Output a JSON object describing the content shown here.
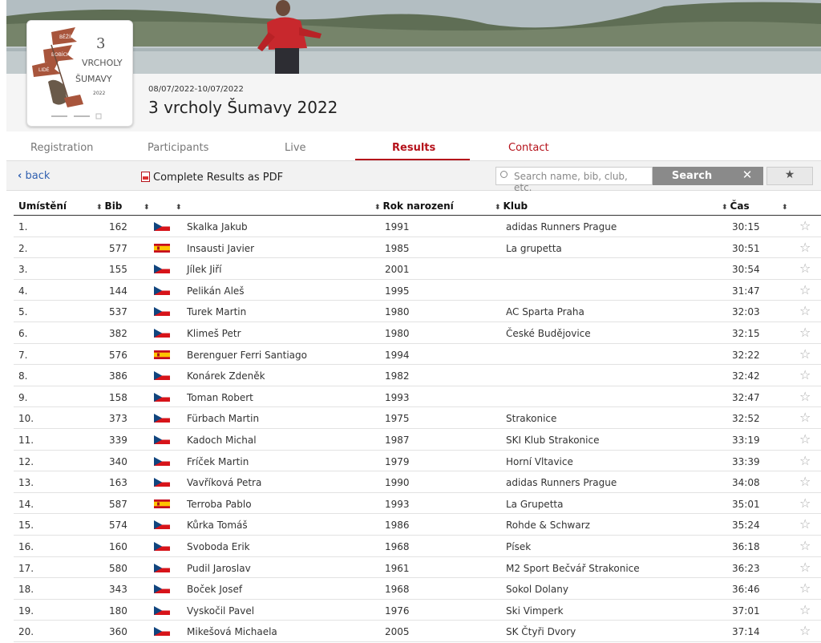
{
  "event": {
    "date": "08/07/2022-10/07/2022",
    "title": "3 vrcholy Šumavy 2022",
    "logo": {
      "numeral": "3",
      "line1": "VRCHOLY",
      "line2": "ŠUMAVY",
      "year": "2022",
      "flag_words": [
        "BĚŽÍNI",
        "BOBÍCI",
        "LIDÉ"
      ]
    }
  },
  "tabs": [
    {
      "label": "Registration"
    },
    {
      "label": "Participants"
    },
    {
      "label": "Live"
    },
    {
      "label": "Results",
      "active": true
    },
    {
      "label": "Contact"
    }
  ],
  "toolbar": {
    "back_label": "back",
    "pdf_label": "Complete Results as PDF",
    "search_placeholder": "Search name, bib, club, etc.",
    "search_label": "Search",
    "clear_label": "✕",
    "favorites_label": "★"
  },
  "columns": {
    "place": "Umístění",
    "bib": "Bib",
    "nation": "",
    "name": "",
    "birth_year": "Rok narození",
    "club": "Klub",
    "time": "Čas"
  },
  "colors": {
    "accent": "#b5121b",
    "link": "#3060b0"
  },
  "rows": [
    {
      "place": "1.",
      "bib": "162",
      "flag": "cz",
      "name": "Skalka Jakub",
      "year": "1991",
      "club": "adidas Runners Prague",
      "time": "30:15"
    },
    {
      "place": "2.",
      "bib": "577",
      "flag": "es",
      "name": "Insausti Javier",
      "year": "1985",
      "club": "La grupetta",
      "time": "30:51"
    },
    {
      "place": "3.",
      "bib": "155",
      "flag": "cz",
      "name": "Jílek Jiří",
      "year": "2001",
      "club": "",
      "time": "30:54"
    },
    {
      "place": "4.",
      "bib": "144",
      "flag": "cz",
      "name": "Pelikán Aleš",
      "year": "1995",
      "club": "",
      "time": "31:47"
    },
    {
      "place": "5.",
      "bib": "537",
      "flag": "cz",
      "name": "Turek Martin",
      "year": "1980",
      "club": "AC Sparta Praha",
      "time": "32:03"
    },
    {
      "place": "6.",
      "bib": "382",
      "flag": "cz",
      "name": "Klimeš Petr",
      "year": "1980",
      "club": "České Budějovice",
      "time": "32:15"
    },
    {
      "place": "7.",
      "bib": "576",
      "flag": "es",
      "name": "Berenguer Ferri Santiago",
      "year": "1994",
      "club": "",
      "time": "32:22"
    },
    {
      "place": "8.",
      "bib": "386",
      "flag": "cz",
      "name": "Konárek Zdeněk",
      "year": "1982",
      "club": "",
      "time": "32:42"
    },
    {
      "place": "9.",
      "bib": "158",
      "flag": "cz",
      "name": "Toman Robert",
      "year": "1993",
      "club": "",
      "time": "32:47"
    },
    {
      "place": "10.",
      "bib": "373",
      "flag": "cz",
      "name": "Fürbach Martin",
      "year": "1975",
      "club": "Strakonice",
      "time": "32:52"
    },
    {
      "place": "11.",
      "bib": "339",
      "flag": "cz",
      "name": "Kadoch Michal",
      "year": "1987",
      "club": "SKI Klub Strakonice",
      "time": "33:19"
    },
    {
      "place": "12.",
      "bib": "340",
      "flag": "cz",
      "name": "Fríček Martin",
      "year": "1979",
      "club": "Horní Vltavice",
      "time": "33:39"
    },
    {
      "place": "13.",
      "bib": "163",
      "flag": "cz",
      "name": "Vavříková Petra",
      "year": "1990",
      "club": "adidas Runners Prague",
      "time": "34:08"
    },
    {
      "place": "14.",
      "bib": "587",
      "flag": "es",
      "name": "Terroba Pablo",
      "year": "1993",
      "club": "La Grupetta",
      "time": "35:01"
    },
    {
      "place": "15.",
      "bib": "574",
      "flag": "cz",
      "name": "Kůrka Tomáš",
      "year": "1986",
      "club": "Rohde & Schwarz",
      "time": "35:24"
    },
    {
      "place": "16.",
      "bib": "160",
      "flag": "cz",
      "name": "Svoboda Erik",
      "year": "1968",
      "club": "Písek",
      "time": "36:18"
    },
    {
      "place": "17.",
      "bib": "580",
      "flag": "cz",
      "name": "Pudil Jaroslav",
      "year": "1961",
      "club": "M2 Sport Bečvář Strakonice",
      "time": "36:23"
    },
    {
      "place": "18.",
      "bib": "343",
      "flag": "cz",
      "name": "Boček Josef",
      "year": "1968",
      "club": "Sokol Dolany",
      "time": "36:46"
    },
    {
      "place": "19.",
      "bib": "180",
      "flag": "cz",
      "name": "Vyskočil Pavel",
      "year": "1976",
      "club": "Ski Vimperk",
      "time": "37:01"
    },
    {
      "place": "20.",
      "bib": "360",
      "flag": "cz",
      "name": "Mikešová Michaela",
      "year": "2005",
      "club": "SK Čtyři Dvory",
      "time": "37:14"
    }
  ]
}
